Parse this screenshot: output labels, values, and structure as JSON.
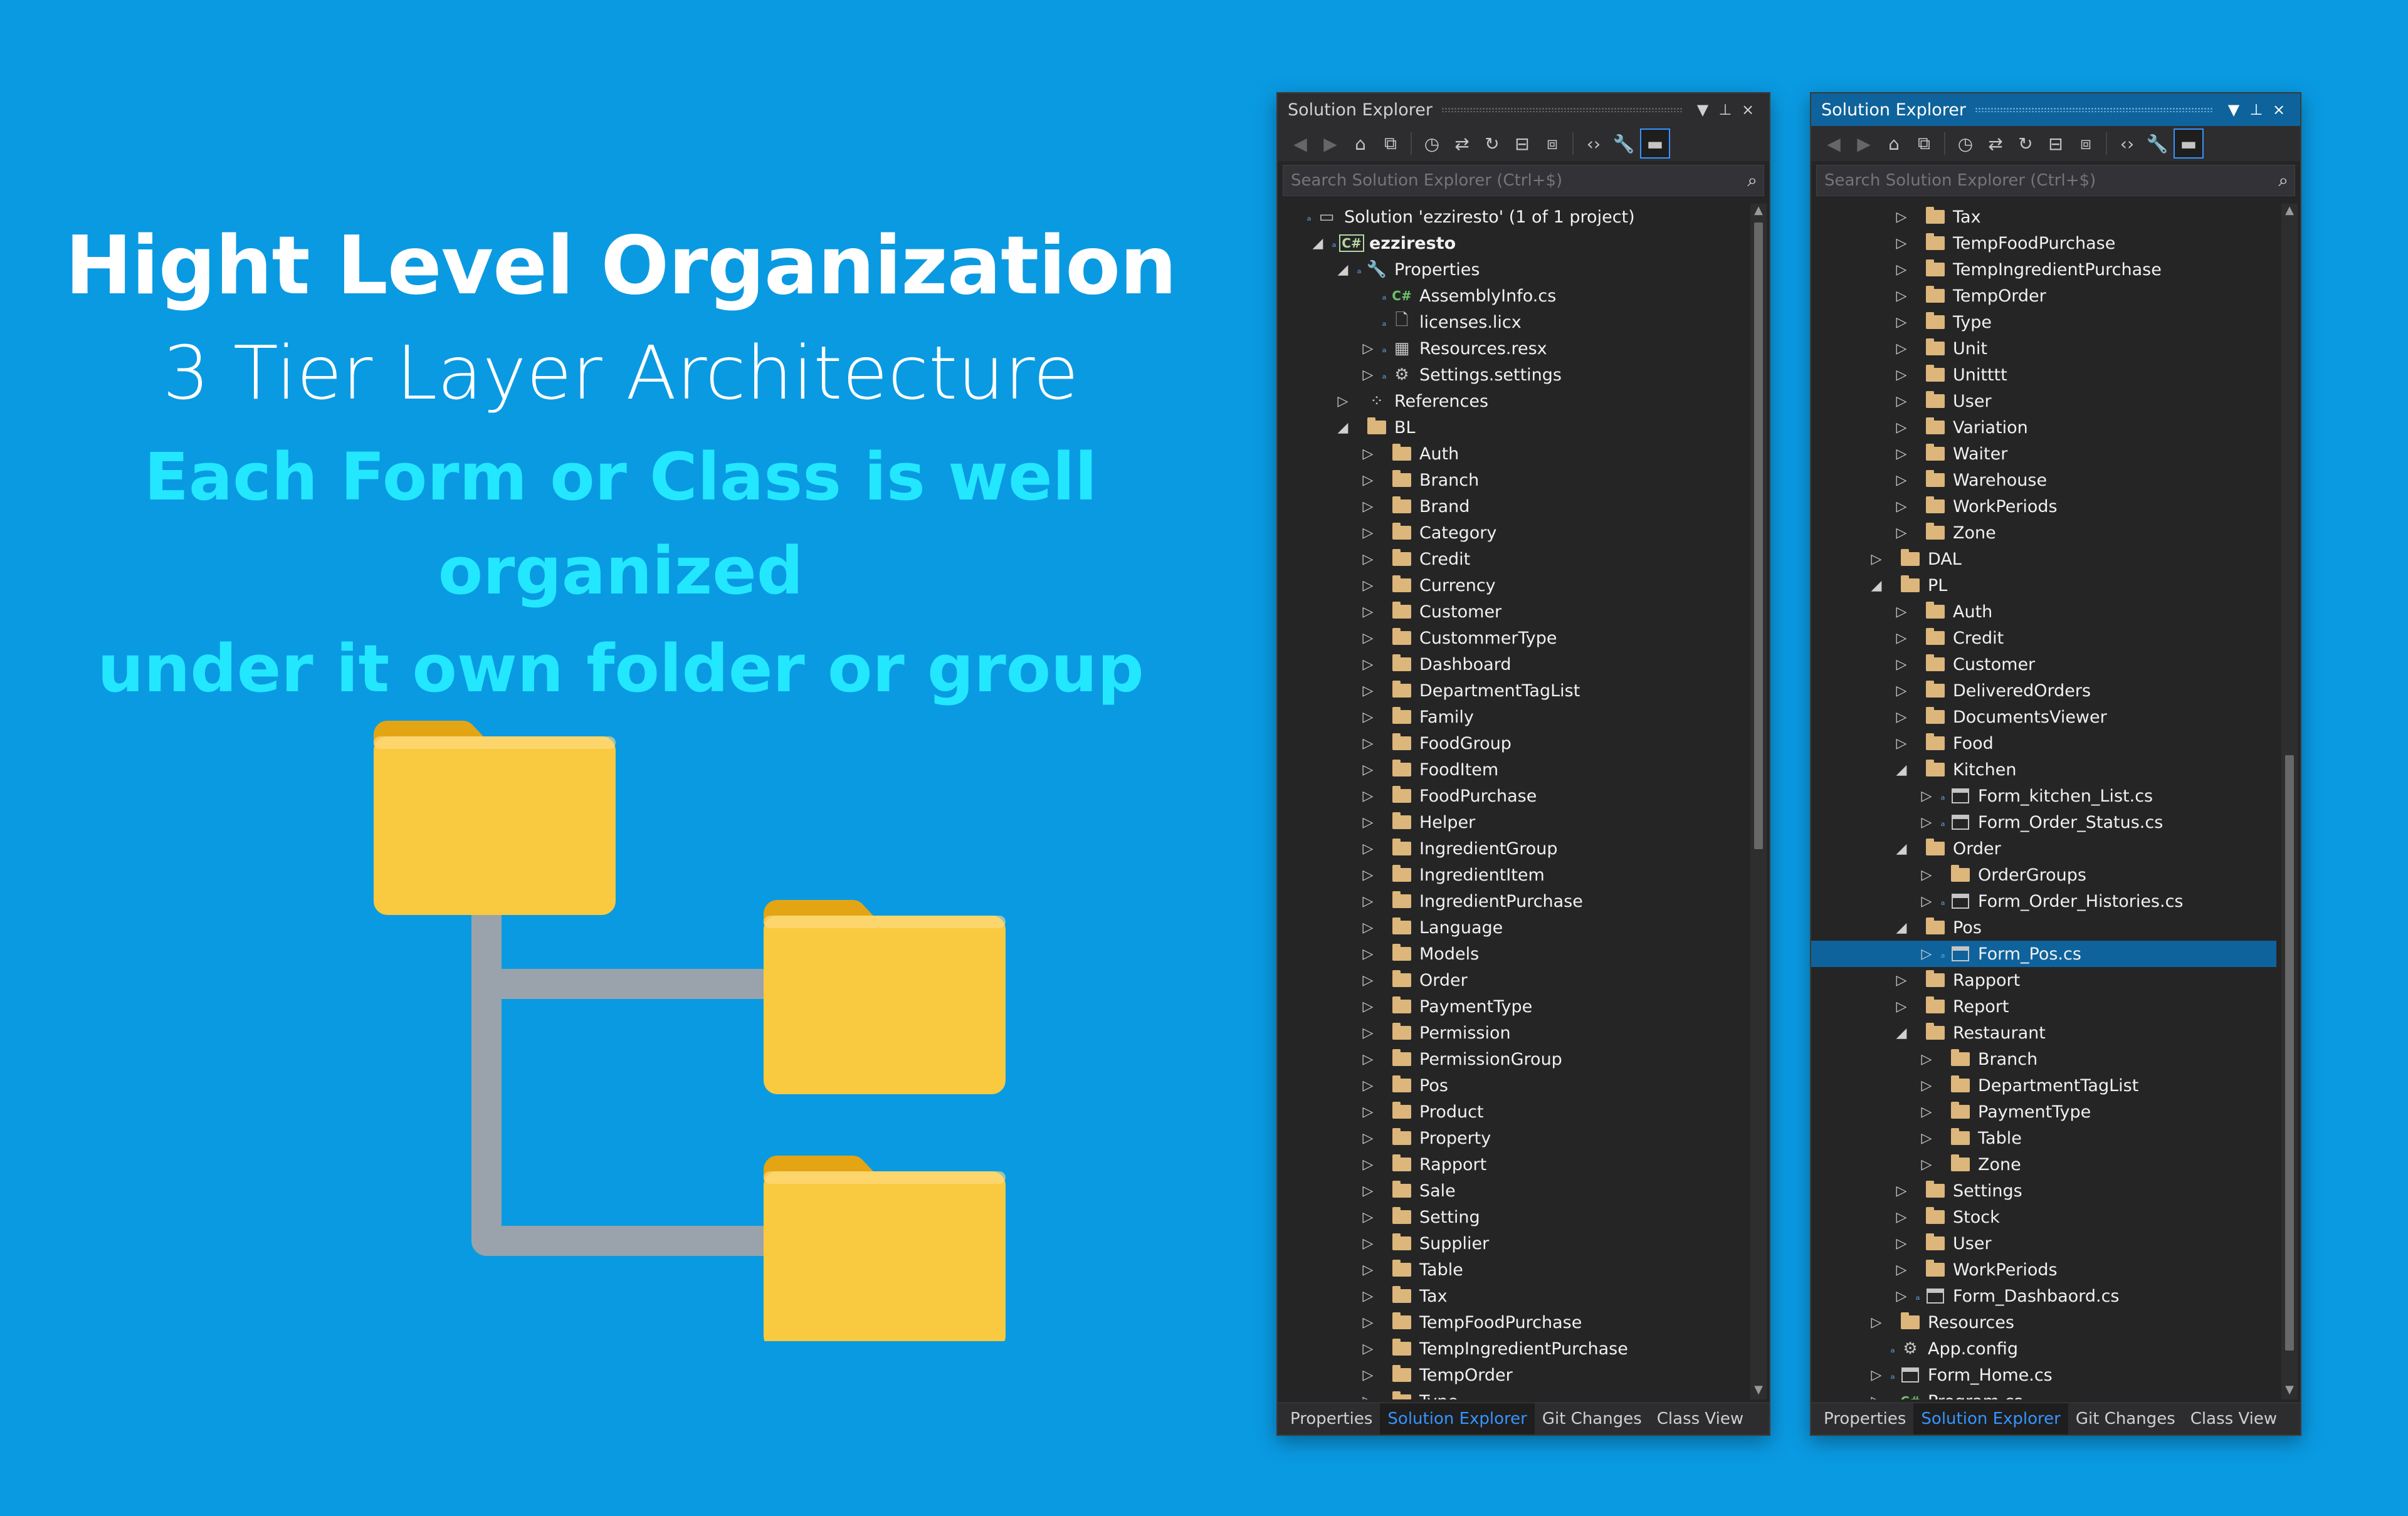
{
  "hero": {
    "title": "Hight Level Organization",
    "subtitle": "3 Tier Layer Architecture",
    "tagline_1": "Each Form or Class is well organized",
    "tagline_2": "under it own folder or group"
  },
  "colors": {
    "background": "#0a9ae2",
    "tagline": "#23e7ff",
    "folder": "#f9c93f",
    "connector": "#9aa3ab",
    "selection": "#0e639c"
  },
  "icons": {
    "close": "×",
    "pin": "⊥",
    "dropdown": "▼",
    "search": "⌕",
    "expand": "▷",
    "collapse": "◢",
    "lock": "🔒"
  },
  "left_panel": {
    "title": "Solution Explorer",
    "search_placeholder": "Search Solution Explorer (Ctrl+$)",
    "tabs": [
      "Properties",
      "Solution Explorer",
      "Git Changes",
      "Class View"
    ],
    "active_tab_index": 1,
    "rows": [
      {
        "label": "Solution 'ezziresto' (1 of 1 project)",
        "indent": 0,
        "exp": "",
        "icon": "solution",
        "lock": true
      },
      {
        "label": "ezziresto",
        "indent": 1,
        "exp": "collapse",
        "icon": "project",
        "lock": true
      },
      {
        "label": "Properties",
        "indent": 2,
        "exp": "collapse",
        "icon": "wrench",
        "lock": true
      },
      {
        "label": "AssemblyInfo.cs",
        "indent": 3,
        "exp": "",
        "icon": "cs",
        "lock": true
      },
      {
        "label": "licenses.licx",
        "indent": 3,
        "exp": "",
        "icon": "file",
        "lock": true
      },
      {
        "label": "Resources.resx",
        "indent": 3,
        "exp": "expand",
        "icon": "resx",
        "lock": true
      },
      {
        "label": "Settings.settings",
        "indent": 3,
        "exp": "expand",
        "icon": "gear",
        "lock": true
      },
      {
        "label": "References",
        "indent": 2,
        "exp": "expand",
        "icon": "refs",
        "lock": false
      },
      {
        "label": "BL",
        "indent": 2,
        "exp": "collapse",
        "icon": "folder",
        "lock": false
      },
      {
        "label": "Auth",
        "indent": 3,
        "exp": "expand",
        "icon": "folder",
        "lock": false
      },
      {
        "label": "Branch",
        "indent": 3,
        "exp": "expand",
        "icon": "folder",
        "lock": false
      },
      {
        "label": "Brand",
        "indent": 3,
        "exp": "expand",
        "icon": "folder",
        "lock": false
      },
      {
        "label": "Category",
        "indent": 3,
        "exp": "expand",
        "icon": "folder",
        "lock": false
      },
      {
        "label": "Credit",
        "indent": 3,
        "exp": "expand",
        "icon": "folder",
        "lock": false
      },
      {
        "label": "Currency",
        "indent": 3,
        "exp": "expand",
        "icon": "folder",
        "lock": false
      },
      {
        "label": "Customer",
        "indent": 3,
        "exp": "expand",
        "icon": "folder",
        "lock": false
      },
      {
        "label": "CustommerType",
        "indent": 3,
        "exp": "expand",
        "icon": "folder",
        "lock": false
      },
      {
        "label": "Dashboard",
        "indent": 3,
        "exp": "expand",
        "icon": "folder",
        "lock": false
      },
      {
        "label": "DepartmentTagList",
        "indent": 3,
        "exp": "expand",
        "icon": "folder",
        "lock": false
      },
      {
        "label": "Family",
        "indent": 3,
        "exp": "expand",
        "icon": "folder",
        "lock": false
      },
      {
        "label": "FoodGroup",
        "indent": 3,
        "exp": "expand",
        "icon": "folder",
        "lock": false
      },
      {
        "label": "FoodItem",
        "indent": 3,
        "exp": "expand",
        "icon": "folder",
        "lock": false
      },
      {
        "label": "FoodPurchase",
        "indent": 3,
        "exp": "expand",
        "icon": "folder",
        "lock": false
      },
      {
        "label": "Helper",
        "indent": 3,
        "exp": "expand",
        "icon": "folder",
        "lock": false
      },
      {
        "label": "IngredientGroup",
        "indent": 3,
        "exp": "expand",
        "icon": "folder",
        "lock": false
      },
      {
        "label": "IngredientItem",
        "indent": 3,
        "exp": "expand",
        "icon": "folder",
        "lock": false
      },
      {
        "label": "IngredientPurchase",
        "indent": 3,
        "exp": "expand",
        "icon": "folder",
        "lock": false
      },
      {
        "label": "Language",
        "indent": 3,
        "exp": "expand",
        "icon": "folder",
        "lock": false
      },
      {
        "label": "Models",
        "indent": 3,
        "exp": "expand",
        "icon": "folder",
        "lock": false
      },
      {
        "label": "Order",
        "indent": 3,
        "exp": "expand",
        "icon": "folder",
        "lock": false
      },
      {
        "label": "PaymentType",
        "indent": 3,
        "exp": "expand",
        "icon": "folder",
        "lock": false
      },
      {
        "label": "Permission",
        "indent": 3,
        "exp": "expand",
        "icon": "folder",
        "lock": false
      },
      {
        "label": "PermissionGroup",
        "indent": 3,
        "exp": "expand",
        "icon": "folder",
        "lock": false
      },
      {
        "label": "Pos",
        "indent": 3,
        "exp": "expand",
        "icon": "folder",
        "lock": false
      },
      {
        "label": "Product",
        "indent": 3,
        "exp": "expand",
        "icon": "folder",
        "lock": false
      },
      {
        "label": "Property",
        "indent": 3,
        "exp": "expand",
        "icon": "folder",
        "lock": false
      },
      {
        "label": "Rapport",
        "indent": 3,
        "exp": "expand",
        "icon": "folder",
        "lock": false
      },
      {
        "label": "Sale",
        "indent": 3,
        "exp": "expand",
        "icon": "folder",
        "lock": false
      },
      {
        "label": "Setting",
        "indent": 3,
        "exp": "expand",
        "icon": "folder",
        "lock": false
      },
      {
        "label": "Supplier",
        "indent": 3,
        "exp": "expand",
        "icon": "folder",
        "lock": false
      },
      {
        "label": "Table",
        "indent": 3,
        "exp": "expand",
        "icon": "folder",
        "lock": false
      },
      {
        "label": "Tax",
        "indent": 3,
        "exp": "expand",
        "icon": "folder",
        "lock": false
      },
      {
        "label": "TempFoodPurchase",
        "indent": 3,
        "exp": "expand",
        "icon": "folder",
        "lock": false
      },
      {
        "label": "TempIngredientPurchase",
        "indent": 3,
        "exp": "expand",
        "icon": "folder",
        "lock": false
      },
      {
        "label": "TempOrder",
        "indent": 3,
        "exp": "expand",
        "icon": "folder",
        "lock": false
      },
      {
        "label": "Type",
        "indent": 3,
        "exp": "expand",
        "icon": "folder",
        "lock": false
      }
    ]
  },
  "right_panel": {
    "title": "Solution Explorer",
    "search_placeholder": "Search Solution Explorer (Ctrl+$)",
    "tabs": [
      "Properties",
      "Solution Explorer",
      "Git Changes",
      "Class View"
    ],
    "active_tab_index": 1,
    "rows": [
      {
        "label": "Tax",
        "indent": 3,
        "exp": "expand",
        "icon": "folder",
        "lock": false
      },
      {
        "label": "TempFoodPurchase",
        "indent": 3,
        "exp": "expand",
        "icon": "folder",
        "lock": false
      },
      {
        "label": "TempIngredientPurchase",
        "indent": 3,
        "exp": "expand",
        "icon": "folder",
        "lock": false
      },
      {
        "label": "TempOrder",
        "indent": 3,
        "exp": "expand",
        "icon": "folder",
        "lock": false
      },
      {
        "label": "Type",
        "indent": 3,
        "exp": "expand",
        "icon": "folder",
        "lock": false
      },
      {
        "label": "Unit",
        "indent": 3,
        "exp": "expand",
        "icon": "folder",
        "lock": false
      },
      {
        "label": "Unitttt",
        "indent": 3,
        "exp": "expand",
        "icon": "folder",
        "lock": false
      },
      {
        "label": "User",
        "indent": 3,
        "exp": "expand",
        "icon": "folder",
        "lock": false
      },
      {
        "label": "Variation",
        "indent": 3,
        "exp": "expand",
        "icon": "folder",
        "lock": false
      },
      {
        "label": "Waiter",
        "indent": 3,
        "exp": "expand",
        "icon": "folder",
        "lock": false
      },
      {
        "label": "Warehouse",
        "indent": 3,
        "exp": "expand",
        "icon": "folder",
        "lock": false
      },
      {
        "label": "WorkPeriods",
        "indent": 3,
        "exp": "expand",
        "icon": "folder",
        "lock": false
      },
      {
        "label": "Zone",
        "indent": 3,
        "exp": "expand",
        "icon": "folder",
        "lock": false
      },
      {
        "label": "DAL",
        "indent": 2,
        "exp": "expand",
        "icon": "folder",
        "lock": false
      },
      {
        "label": "PL",
        "indent": 2,
        "exp": "collapse",
        "icon": "folder",
        "lock": false
      },
      {
        "label": "Auth",
        "indent": 3,
        "exp": "expand",
        "icon": "folder",
        "lock": false
      },
      {
        "label": "Credit",
        "indent": 3,
        "exp": "expand",
        "icon": "folder",
        "lock": false
      },
      {
        "label": "Customer",
        "indent": 3,
        "exp": "expand",
        "icon": "folder",
        "lock": false
      },
      {
        "label": "DeliveredOrders",
        "indent": 3,
        "exp": "expand",
        "icon": "folder",
        "lock": false
      },
      {
        "label": "DocumentsViewer",
        "indent": 3,
        "exp": "expand",
        "icon": "folder",
        "lock": false
      },
      {
        "label": "Food",
        "indent": 3,
        "exp": "expand",
        "icon": "folder",
        "lock": false
      },
      {
        "label": "Kitchen",
        "indent": 3,
        "exp": "collapse",
        "icon": "folder",
        "lock": false
      },
      {
        "label": "Form_kitchen_List.cs",
        "indent": 4,
        "exp": "expand",
        "icon": "form",
        "lock": true
      },
      {
        "label": "Form_Order_Status.cs",
        "indent": 4,
        "exp": "expand",
        "icon": "form",
        "lock": true
      },
      {
        "label": "Order",
        "indent": 3,
        "exp": "collapse",
        "icon": "folder",
        "lock": false
      },
      {
        "label": "OrderGroups",
        "indent": 4,
        "exp": "expand",
        "icon": "folder",
        "lock": false
      },
      {
        "label": "Form_Order_Histories.cs",
        "indent": 4,
        "exp": "expand",
        "icon": "form",
        "lock": true
      },
      {
        "label": "Pos",
        "indent": 3,
        "exp": "collapse",
        "icon": "folder",
        "lock": false
      },
      {
        "label": "Form_Pos.cs",
        "indent": 4,
        "exp": "expand",
        "icon": "form",
        "lock": true,
        "selected": true
      },
      {
        "label": "Rapport",
        "indent": 3,
        "exp": "expand",
        "icon": "folder",
        "lock": false
      },
      {
        "label": "Report",
        "indent": 3,
        "exp": "expand",
        "icon": "folder",
        "lock": false
      },
      {
        "label": "Restaurant",
        "indent": 3,
        "exp": "collapse",
        "icon": "folder",
        "lock": false
      },
      {
        "label": "Branch",
        "indent": 4,
        "exp": "expand",
        "icon": "folder",
        "lock": false
      },
      {
        "label": "DepartmentTagList",
        "indent": 4,
        "exp": "expand",
        "icon": "folder",
        "lock": false
      },
      {
        "label": "PaymentType",
        "indent": 4,
        "exp": "expand",
        "icon": "folder",
        "lock": false
      },
      {
        "label": "Table",
        "indent": 4,
        "exp": "expand",
        "icon": "folder",
        "lock": false
      },
      {
        "label": "Zone",
        "indent": 4,
        "exp": "expand",
        "icon": "folder",
        "lock": false
      },
      {
        "label": "Settings",
        "indent": 3,
        "exp": "expand",
        "icon": "folder",
        "lock": false
      },
      {
        "label": "Stock",
        "indent": 3,
        "exp": "expand",
        "icon": "folder",
        "lock": false
      },
      {
        "label": "User",
        "indent": 3,
        "exp": "expand",
        "icon": "folder",
        "lock": false
      },
      {
        "label": "WorkPeriods",
        "indent": 3,
        "exp": "expand",
        "icon": "folder",
        "lock": false
      },
      {
        "label": "Form_Dashbaord.cs",
        "indent": 3,
        "exp": "expand",
        "icon": "form",
        "lock": true
      },
      {
        "label": "Resources",
        "indent": 2,
        "exp": "expand",
        "icon": "folder",
        "lock": false
      },
      {
        "label": "App.config",
        "indent": 2,
        "exp": "",
        "icon": "config",
        "lock": true
      },
      {
        "label": "Form_Home.cs",
        "indent": 2,
        "exp": "expand",
        "icon": "form",
        "lock": true
      },
      {
        "label": "Program.cs",
        "indent": 2,
        "exp": "expand",
        "icon": "cs",
        "lock": true
      }
    ]
  }
}
